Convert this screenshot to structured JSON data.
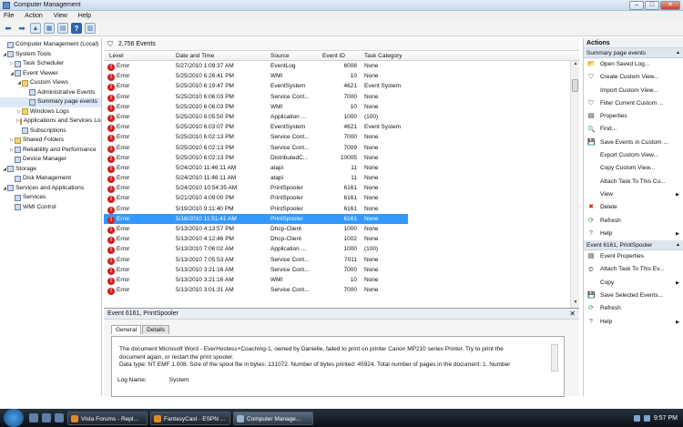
{
  "window": {
    "title": "Computer Management"
  },
  "menu": [
    "File",
    "Action",
    "View",
    "Help"
  ],
  "tree": [
    {
      "label": "Computer Management (Local)",
      "level": 0,
      "exp": "",
      "icon": "computer-icon"
    },
    {
      "label": "System Tools",
      "level": 0,
      "exp": "◢",
      "icon": "tools-icon"
    },
    {
      "label": "Task Scheduler",
      "level": 1,
      "exp": "▷",
      "icon": "clock-icon"
    },
    {
      "label": "Event Viewer",
      "level": 1,
      "exp": "◢",
      "icon": "event-viewer-icon"
    },
    {
      "label": "Custom Views",
      "level": 2,
      "exp": "◢",
      "icon": "folder-icon"
    },
    {
      "label": "Administrative Events",
      "level": 3,
      "exp": "",
      "icon": "filter-icon"
    },
    {
      "label": "Summary page events",
      "level": 3,
      "exp": "",
      "icon": "filter-icon",
      "selected": true
    },
    {
      "label": "Windows Logs",
      "level": 2,
      "exp": "▷",
      "icon": "folder-icon"
    },
    {
      "label": "Applications and Services Logs",
      "level": 2,
      "exp": "▷",
      "icon": "folder-icon"
    },
    {
      "label": "Subscriptions",
      "level": 2,
      "exp": "",
      "icon": "subscriptions-icon"
    },
    {
      "label": "Shared Folders",
      "level": 1,
      "exp": "▷",
      "icon": "folder-icon"
    },
    {
      "label": "Reliability and Performance",
      "level": 1,
      "exp": "▷",
      "icon": "performance-icon"
    },
    {
      "label": "Device Manager",
      "level": 1,
      "exp": "",
      "icon": "device-icon"
    },
    {
      "label": "Storage",
      "level": 0,
      "exp": "◢",
      "icon": "storage-icon"
    },
    {
      "label": "Disk Management",
      "level": 1,
      "exp": "",
      "icon": "disk-icon"
    },
    {
      "label": "Services and Applications",
      "level": 0,
      "exp": "◢",
      "icon": "services-icon"
    },
    {
      "label": "Services",
      "level": 1,
      "exp": "",
      "icon": "gear-icon"
    },
    {
      "label": "WMI Control",
      "level": 1,
      "exp": "",
      "icon": "wmi-icon"
    }
  ],
  "events": {
    "count_label": "2,756 Events",
    "columns": [
      "Level",
      "Date and Time",
      "Source",
      "Event ID",
      "Task Category"
    ],
    "rows": [
      [
        "Error",
        "5/27/2010 1:09:37 AM",
        "EventLog",
        "6008",
        "None"
      ],
      [
        "Error",
        "5/25/2010 6:26:41 PM",
        "WMI",
        "10",
        "None"
      ],
      [
        "Error",
        "5/25/2010 6:19:47 PM",
        "EventSystem",
        "4621",
        "Event System"
      ],
      [
        "Error",
        "5/25/2010 6:06:03 PM",
        "Service Cont...",
        "7000",
        "None"
      ],
      [
        "Error",
        "5/25/2010 6:06:03 PM",
        "WMI",
        "10",
        "None"
      ],
      [
        "Error",
        "5/25/2010 6:05:50 PM",
        "Application ...",
        "1000",
        "(100)"
      ],
      [
        "Error",
        "5/25/2010 6:03:07 PM",
        "EventSystem",
        "4621",
        "Event System"
      ],
      [
        "Error",
        "5/25/2010 6:02:13 PM",
        "Service Cont...",
        "7000",
        "None"
      ],
      [
        "Error",
        "5/25/2010 6:02:13 PM",
        "Service Cont...",
        "7009",
        "None"
      ],
      [
        "Error",
        "5/25/2010 6:02:13 PM",
        "DistributedC...",
        "10005",
        "None"
      ],
      [
        "Error",
        "5/24/2010 11:46:11 AM",
        "atapi",
        "11",
        "None"
      ],
      [
        "Error",
        "5/24/2010 11:46:11 AM",
        "atapi",
        "11",
        "None"
      ],
      [
        "Error",
        "5/24/2010 10:54:35 AM",
        "PrintSpooler",
        "6161",
        "None"
      ],
      [
        "Error",
        "5/21/2010 4:09:00 PM",
        "PrintSpooler",
        "6161",
        "None"
      ],
      [
        "Error",
        "5/19/2010 9:11:40 PM",
        "PrintSpooler",
        "6161",
        "None"
      ],
      [
        "Error",
        "5/18/2010 11:51:41 AM",
        "PrintSpooler",
        "6161",
        "None"
      ],
      [
        "Error",
        "5/13/2010 4:13:57 PM",
        "Dhcp-Client",
        "1000",
        "None"
      ],
      [
        "Error",
        "5/13/2010 4:12:46 PM",
        "Dhcp-Client",
        "1002",
        "None"
      ],
      [
        "Error",
        "5/13/2010 7:06:02 AM",
        "Application ...",
        "1000",
        "(100)"
      ],
      [
        "Error",
        "5/13/2010 7:05:53 AM",
        "Service Cont...",
        "7011",
        "None"
      ],
      [
        "Error",
        "5/13/2010 3:21:16 AM",
        "Service Cont...",
        "7000",
        "None"
      ],
      [
        "Error",
        "5/13/2010 3:21:16 AM",
        "WMI",
        "10",
        "None"
      ],
      [
        "Error",
        "5/13/2010 3:01:31 AM",
        "Service Cont...",
        "7000",
        "None"
      ]
    ],
    "selected_index": 15
  },
  "detail": {
    "header": "Event 6161, PrintSpooler",
    "tabs": [
      "General",
      "Details"
    ],
    "message_line1": "The document Microsoft Word - EverHostess+Coaching-1, owned by Danielle, failed to print on printer Canon MP210 series Printer. Try to print the",
    "message_line2": "document again, or restart the print spooler.",
    "message_line3": "Data type: NT EMF 1.008. Size of the spool file in bytes: 131072. Number of bytes printed: 45924. Total number of pages in the document: 1. Number",
    "log_name_label": "Log Name:",
    "log_name_value": "System"
  },
  "actions": {
    "title": "Actions",
    "sections": [
      {
        "header": "Summary page events",
        "items": [
          {
            "label": "Open Saved Log...",
            "icon": "open-icon",
            "submenu": false
          },
          {
            "label": "Create Custom View...",
            "icon": "filter-icon",
            "submenu": false
          },
          {
            "label": "Import Custom View...",
            "icon": "",
            "submenu": false
          },
          {
            "label": "Filter Current Custom ...",
            "icon": "filter-icon",
            "submenu": false
          },
          {
            "label": "Properties",
            "icon": "properties-icon",
            "submenu": false
          },
          {
            "label": "Find...",
            "icon": "find-icon",
            "submenu": false
          },
          {
            "label": "Save Events in Custom ...",
            "icon": "save-icon",
            "submenu": false
          },
          {
            "label": "Export Custom View...",
            "icon": "",
            "submenu": false
          },
          {
            "label": "Copy Custom View...",
            "icon": "",
            "submenu": false
          },
          {
            "label": "Attach Task To This Cu...",
            "icon": "",
            "submenu": false
          },
          {
            "label": "View",
            "icon": "",
            "submenu": true
          },
          {
            "label": "Delete",
            "icon": "delete-icon",
            "submenu": false
          },
          {
            "label": "Refresh",
            "icon": "refresh-icon",
            "submenu": false
          },
          {
            "label": "Help",
            "icon": "help-icon",
            "submenu": true
          }
        ]
      },
      {
        "header": "Event 6161, PrintSpooler",
        "items": [
          {
            "label": "Event Properties",
            "icon": "properties-icon",
            "submenu": false
          },
          {
            "label": "Attach Task To This Ev...",
            "icon": "task-icon",
            "submenu": false
          },
          {
            "label": "Copy",
            "icon": "",
            "submenu": true
          },
          {
            "label": "Save Selected Events...",
            "icon": "save-icon",
            "submenu": false
          },
          {
            "label": "Refresh",
            "icon": "refresh-icon",
            "submenu": false
          },
          {
            "label": "Help",
            "icon": "help-icon",
            "submenu": true
          }
        ]
      }
    ]
  },
  "taskbar": {
    "tasks": [
      "Vista Forums - Repl...",
      "FantasyCast - ESPN ...",
      "Computer Manage..."
    ],
    "active_index": 2,
    "clock": "9:57 PM"
  },
  "colors": {
    "selection": "#3399ff",
    "error": "#d21f1f"
  }
}
